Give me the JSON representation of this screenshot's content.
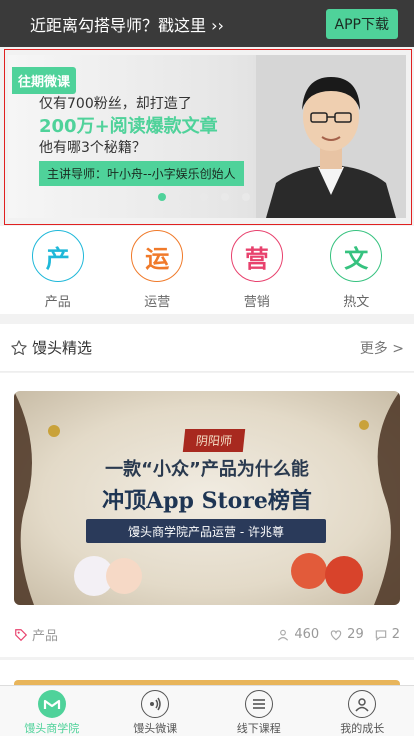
{
  "promo": {
    "text": "近距离勾搭导师？戳这里 ››",
    "app_button": "APP下载"
  },
  "banner": {
    "tag": "往期微课",
    "line1": "仅有700粉丝，却打造了",
    "line2": "200万+阅读爆款文章",
    "line3": "他有哪3个秘籍？",
    "mentor": "主讲导师：叶小舟--小字娱乐创始人",
    "dots": 5,
    "active_dot": 0
  },
  "categories": [
    {
      "icon_char": "产",
      "label": "产品",
      "color": "#1fb8d9"
    },
    {
      "icon_char": "运",
      "label": "运营",
      "color": "#f07a2a"
    },
    {
      "icon_char": "营",
      "label": "营销",
      "color": "#e8416d"
    },
    {
      "icon_char": "文",
      "label": "热文",
      "color": "#36c27f"
    }
  ],
  "section": {
    "title": "馒头精选",
    "more": "更多 >"
  },
  "course": {
    "image": {
      "tag": "阴阳师",
      "line1": "一款“小众”产品为什么能",
      "line2": "冲顶App Store榜首",
      "bar": "馒头商学院产品运营 - 许兆尊"
    },
    "category": "产品",
    "views": "460",
    "likes": "29",
    "comments": "2"
  },
  "tabs": [
    {
      "label": "馒头商学院",
      "icon": "home-icon",
      "active": true
    },
    {
      "label": "馒头微课",
      "icon": "audio-icon",
      "active": false
    },
    {
      "label": "线下课程",
      "icon": "menu-icon",
      "active": false
    },
    {
      "label": "我的成长",
      "icon": "profile-icon",
      "active": false
    }
  ]
}
